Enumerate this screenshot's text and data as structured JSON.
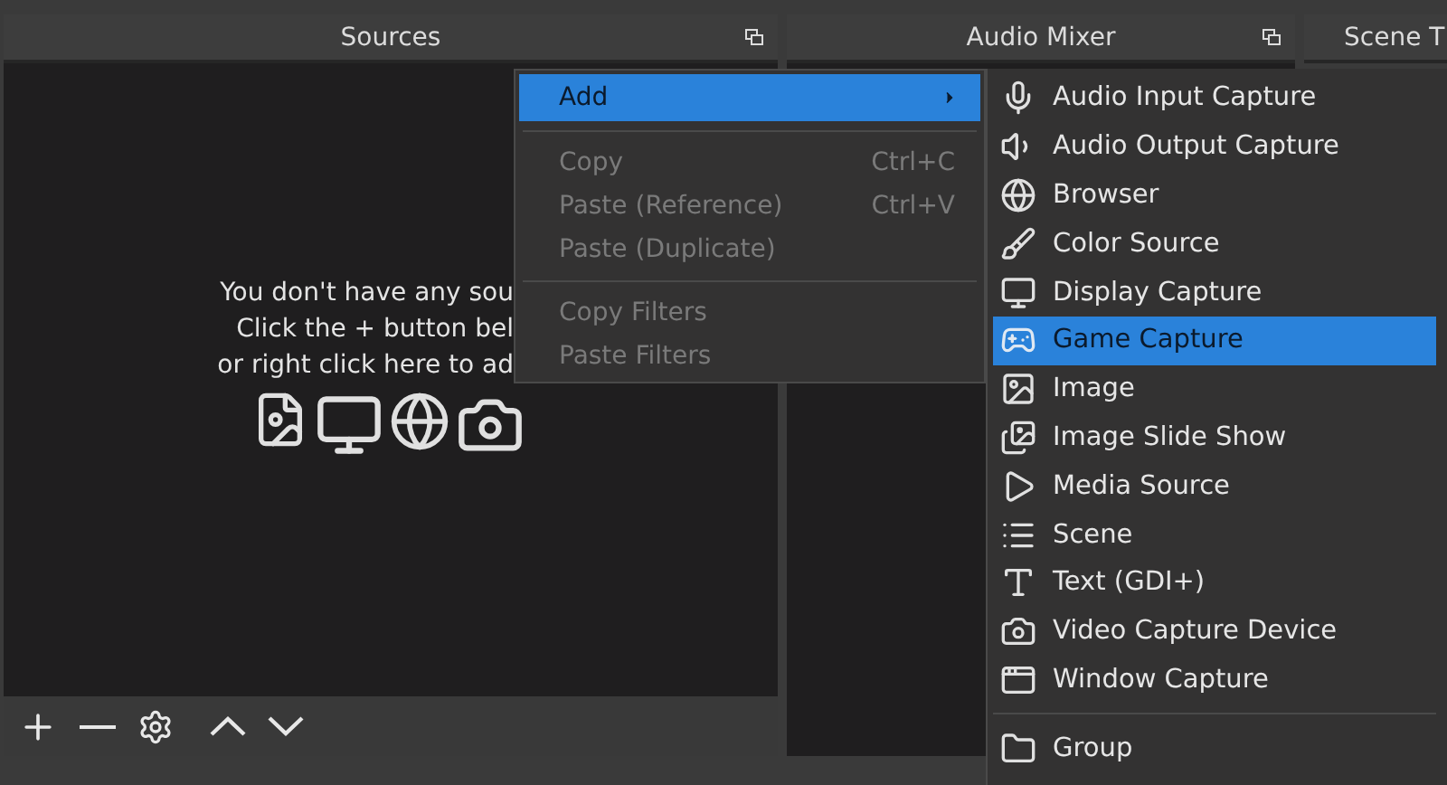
{
  "sources": {
    "title": "Sources",
    "empty_message": [
      "You don't have any sou",
      "Click the + button bel",
      "or right click here to ad"
    ]
  },
  "audio_mixer": {
    "title": "Audio Mixer"
  },
  "scene_transitions": {
    "title": "Scene T"
  },
  "context_menu": {
    "items": [
      {
        "kind": "submenu",
        "label": "Add",
        "selected": true,
        "disabled": false
      },
      {
        "kind": "separator"
      },
      {
        "kind": "action",
        "label": "Copy",
        "shortcut": "Ctrl+C",
        "selected": false,
        "disabled": true
      },
      {
        "kind": "action",
        "label": "Paste (Reference)",
        "shortcut": "Ctrl+V",
        "selected": false,
        "disabled": true
      },
      {
        "kind": "action",
        "label": "Paste (Duplicate)",
        "selected": false,
        "disabled": true
      },
      {
        "kind": "separator"
      },
      {
        "kind": "action",
        "label": "Copy Filters",
        "selected": false,
        "disabled": true
      },
      {
        "kind": "action",
        "label": "Paste Filters",
        "selected": false,
        "disabled": true
      }
    ]
  },
  "add_submenu": {
    "items": [
      {
        "kind": "audio_input",
        "label": "Audio Input Capture",
        "selected": false
      },
      {
        "kind": "audio_output",
        "label": "Audio Output Capture",
        "selected": false
      },
      {
        "kind": "browser",
        "label": "Browser",
        "selected": false
      },
      {
        "kind": "color",
        "label": "Color Source",
        "selected": false
      },
      {
        "kind": "display",
        "label": "Display Capture",
        "selected": false
      },
      {
        "kind": "game",
        "label": "Game Capture",
        "selected": true
      },
      {
        "kind": "image",
        "label": "Image",
        "selected": false
      },
      {
        "kind": "slideshow",
        "label": "Image Slide Show",
        "selected": false
      },
      {
        "kind": "media",
        "label": "Media Source",
        "selected": false
      },
      {
        "kind": "scene",
        "label": "Scene",
        "selected": false
      },
      {
        "kind": "text",
        "label": "Text (GDI+)",
        "selected": false
      },
      {
        "kind": "video",
        "label": "Video Capture Device",
        "selected": false
      },
      {
        "kind": "window",
        "label": "Window Capture",
        "selected": false
      },
      {
        "kind": "separator"
      },
      {
        "kind": "group",
        "label": "Group",
        "selected": false
      }
    ]
  }
}
